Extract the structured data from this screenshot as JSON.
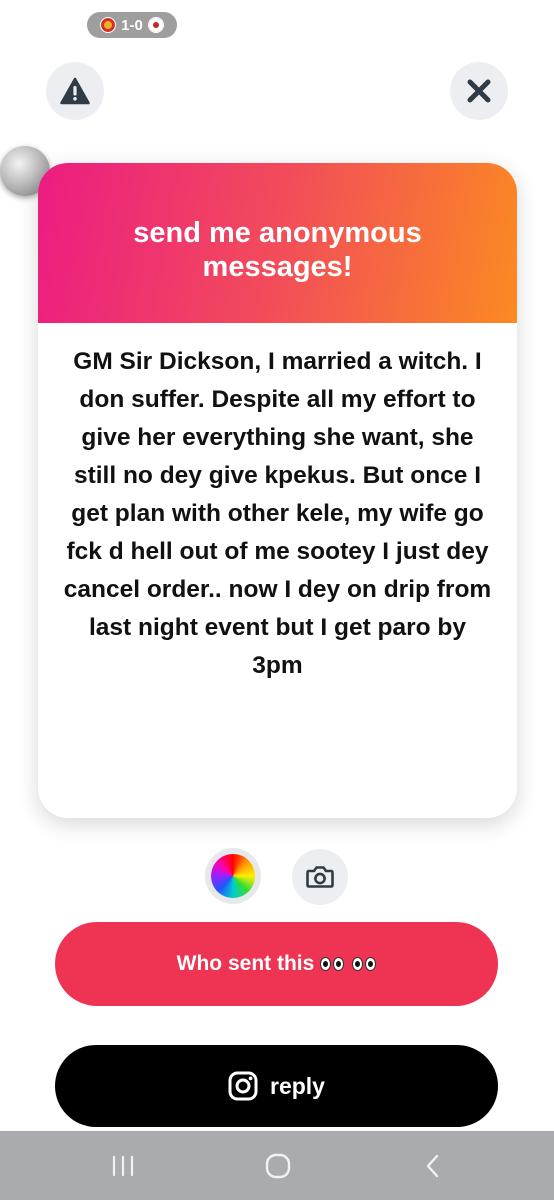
{
  "status": {
    "score": "1-0"
  },
  "card": {
    "title": "send me anonymous messages!",
    "message": "GM Sir Dickson, I married a witch. I don suffer. Despite all my effort to give her everything she want, she still no dey give kpekus. But once I get plan with other kele, my wife go fck d hell out of me sootey I just dey cancel order.. now I dey on drip from last night event but I get paro by 3pm"
  },
  "actions": {
    "who_sent_label": "Who sent this",
    "reply_label": "reply"
  },
  "colors": {
    "gradient_start": "#ec1c82",
    "gradient_end": "#fb8a22",
    "who_button": "#ee3452",
    "reply_button": "#000000"
  },
  "icons": [
    "warning-icon",
    "close-icon",
    "color-wheel-icon",
    "camera-icon",
    "eyes-icon",
    "instagram-icon",
    "recents-icon",
    "home-icon",
    "back-icon"
  ]
}
